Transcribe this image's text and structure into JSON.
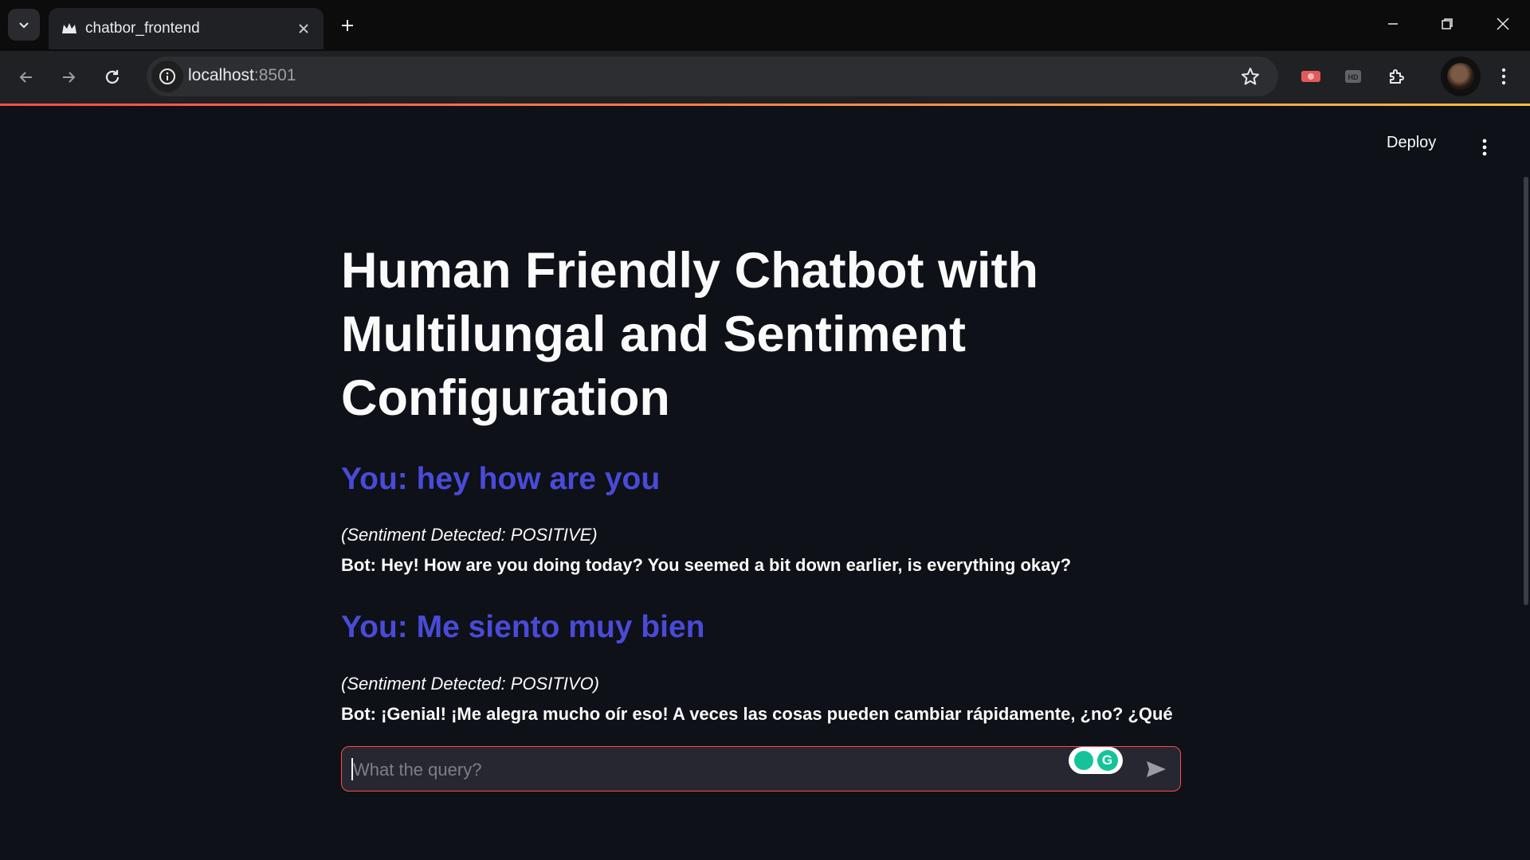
{
  "browser": {
    "tab_title": "chatbor_frontend",
    "url_host": "localhost",
    "url_port": ":8501"
  },
  "app": {
    "deploy_label": "Deploy",
    "title": "Human Friendly Chatbot with Multilungal and Sentiment Configuration",
    "messages": [
      {
        "user": "You: hey how are you",
        "sentiment": "(Sentiment Detected: POSITIVE)",
        "bot": "Bot: Hey! How are you doing today? You seemed a bit down earlier, is everything okay?"
      },
      {
        "user": "You: Me siento muy bien",
        "sentiment": "(Sentiment Detected: POSITIVO)",
        "bot": "Bot: ¡Genial! ¡Me alegra mucho oír eso! A veces las cosas pueden cambiar rápidamente, ¿no? ¿Qué"
      }
    ],
    "input": {
      "placeholder": "What the query?",
      "value": ""
    }
  },
  "colors": {
    "background": "#0e1117",
    "user_text": "#4a4ad9",
    "input_border": "#ff4b4b"
  }
}
